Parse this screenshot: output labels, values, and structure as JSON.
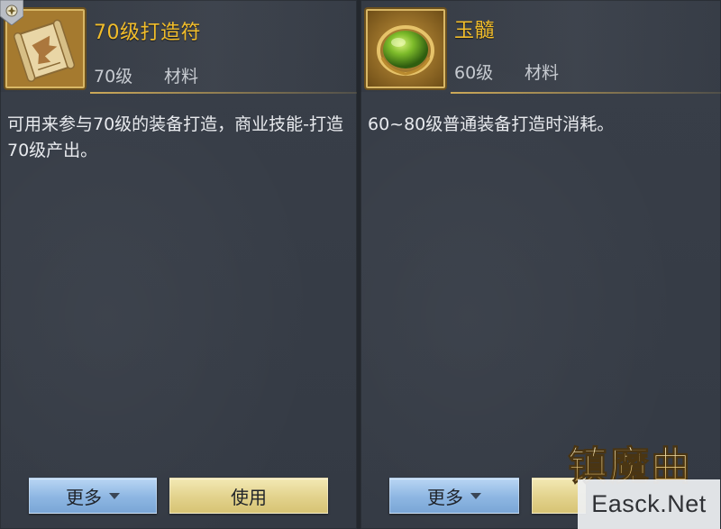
{
  "left_panel": {
    "item_name": "70级打造符",
    "level": "70级",
    "type": "材料",
    "description": "可用来参与70级的装备打造，商业技能-打造70级产出。",
    "icon": "crafting-scroll-icon",
    "more_button": "更多",
    "use_button": "使用"
  },
  "right_panel": {
    "item_name": "玉髓",
    "level": "60级",
    "type": "材料",
    "description": "60~80级普通装备打造时消耗。",
    "icon": "green-jade-gem-icon",
    "more_button": "更多"
  },
  "logo_text": "镇魔曲",
  "watermark": "Easck.Net",
  "colors": {
    "item_name": "#f2bd2a",
    "panel_bg": "#383e48",
    "more_button": "#8db6e2",
    "use_button": "#e2d28c",
    "frame_gold": "#d8b766"
  }
}
